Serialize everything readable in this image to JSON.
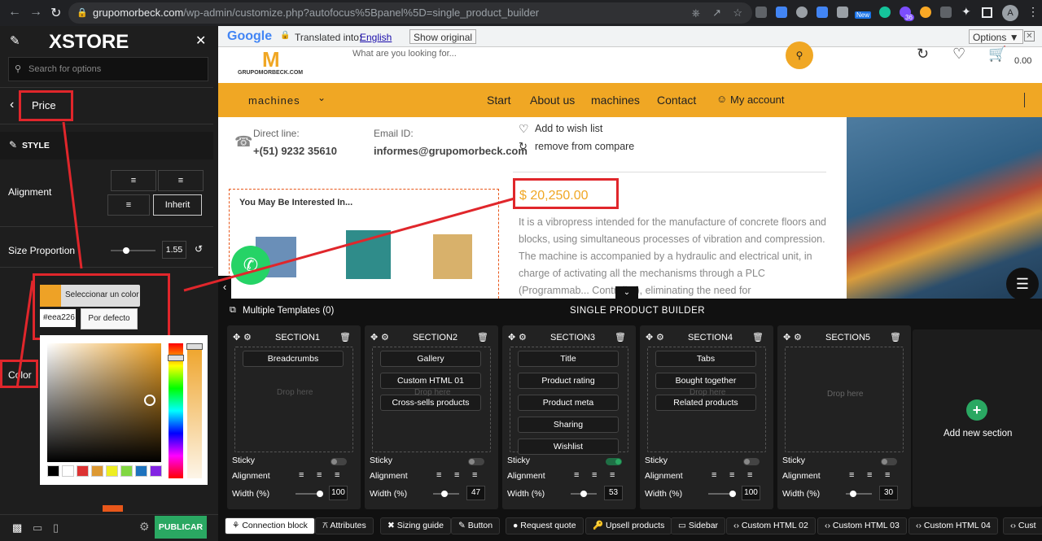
{
  "browser": {
    "url_host": "grupomorbeck.com",
    "url_path": "/wp-admin/customize.php?autofocus%5Bpanel%5D=single_product_builder",
    "new_badge": "New",
    "badge_count": "36",
    "profile_initial": "A"
  },
  "panel": {
    "brand": "XSTORE",
    "search_placeholder": "Search for options",
    "section_title": "Price",
    "style_label": "STYLE",
    "alignment_label": "Alignment",
    "alignment_inherit": "Inherit",
    "size_label": "Size Proportion",
    "size_value": "1.55",
    "size_fraction": 0.35,
    "color_label": "Color",
    "color_swatch": "#eea226",
    "select_color_label": "Seleccionar un color",
    "hex_value": "#eea226",
    "default_button": "Por defecto",
    "palette": [
      "#000000",
      "#ffffff",
      "#dd3333",
      "#dd9933",
      "#eeee22",
      "#81d742",
      "#1e73be",
      "#8224e3"
    ],
    "publish_button": "PUBLICAR"
  },
  "translate_bar": {
    "google": "Google",
    "translated_into": "Translated into:",
    "language": "English",
    "show_original": "Show original",
    "options": "Options ▼"
  },
  "site": {
    "logo_caption": "GRUPOMORBECK.COM",
    "search_placeholder": "What are you looking for...",
    "cart_total": "0.00",
    "menu_machines_dropdown": "machines",
    "menu_items": [
      "Start",
      "About us",
      "machines",
      "Contact"
    ],
    "my_account": "My account",
    "direct_line_label": "Direct line:",
    "direct_line_value": "+(51) 9232 35610",
    "email_label": "Email ID:",
    "email_value": "informes@grupomorbeck.com",
    "wishlist": "Add to wish list",
    "compare": "remove from compare",
    "price": "$ 20,250.00",
    "description": "It is a vibropress intended for the manufacture of concrete floors and blocks, using simultaneous processes of vibration and compression. The machine is accompanied by a hydraulic and electrical unit, in charge of activating all the mechanisms through a PLC (Programmab... Controller), eliminating the need for",
    "interested_title": "You May Be Interested In..."
  },
  "builder": {
    "templates_label": "Multiple Templates (0)",
    "title": "SINGLE PRODUCT BUILDER",
    "add_section": "Add new section",
    "drop_here": "Drop here",
    "sticky_label": "Sticky",
    "alignment_label": "Alignment",
    "width_label": "Width (%)",
    "sections": [
      {
        "name": "SECTION1",
        "blocks": [
          "Breadcrumbs"
        ],
        "width": "100",
        "sticky": "off"
      },
      {
        "name": "SECTION2",
        "blocks": [
          "Gallery",
          "Custom HTML 01",
          "Cross-sells products"
        ],
        "width": "47",
        "sticky": "off"
      },
      {
        "name": "SECTION3",
        "blocks": [
          "Title",
          "Product rating",
          "Product meta",
          "Sharing",
          "Wishlist"
        ],
        "width": "53",
        "sticky": "on"
      },
      {
        "name": "SECTION4",
        "blocks": [
          "Tabs",
          "Bought together",
          "Related products"
        ],
        "width": "100",
        "sticky": "off"
      },
      {
        "name": "SECTION5",
        "blocks": [],
        "width": "30",
        "sticky": "off"
      }
    ],
    "bottom_tabs": [
      "Connection block",
      "Attributes",
      "Sizing guide",
      "Button",
      "Request quote",
      "Upsell products",
      "Sidebar",
      "Custom HTML 02",
      "Custom HTML 03",
      "Custom HTML 04",
      "Cust"
    ]
  }
}
